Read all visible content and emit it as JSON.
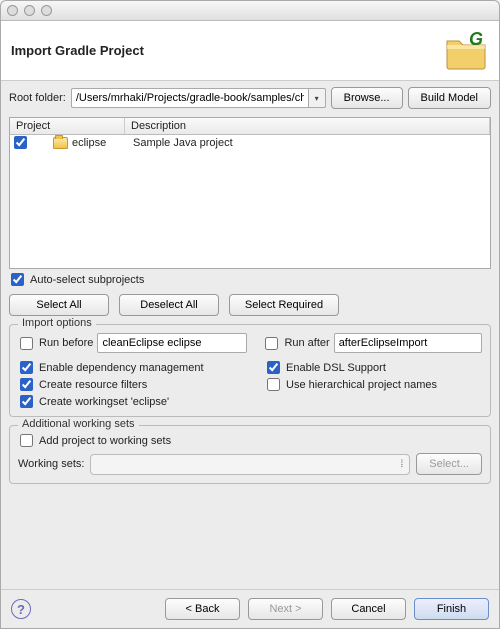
{
  "header": {
    "title": "Import Gradle Project"
  },
  "root_folder": {
    "label": "Root folder:",
    "value": "/Users/mrhaki/Projects/gradle-book/samples/cha",
    "browse": "Browse...",
    "build_model": "Build Model"
  },
  "table": {
    "col_project": "Project",
    "col_description": "Description",
    "rows": [
      {
        "checked": true,
        "name": "eclipse",
        "description": "Sample Java project"
      }
    ]
  },
  "auto_select_label": "Auto-select subprojects",
  "auto_select_checked": true,
  "buttons": {
    "select_all": "Select All",
    "deselect_all": "Deselect All",
    "select_required": "Select Required"
  },
  "import_options": {
    "title": "Import options",
    "run_before_label": "Run before",
    "run_before_value": "cleanEclipse eclipse",
    "run_after_label": "Run after",
    "run_after_value": "afterEclipseImport",
    "enable_dep_mgmt": "Enable dependency management",
    "create_resource_filters": "Create resource filters",
    "create_workingset": "Create workingset 'eclipse'",
    "enable_dsl": "Enable DSL Support",
    "use_hierarchical": "Use hierarchical project names"
  },
  "working_sets": {
    "title": "Additional working sets",
    "add_label": "Add project to working sets",
    "ws_label": "Working sets:",
    "select_btn": "Select..."
  },
  "nav": {
    "back": "< Back",
    "next": "Next >",
    "cancel": "Cancel",
    "finish": "Finish"
  },
  "icons": {
    "gradle_letter": "G"
  }
}
